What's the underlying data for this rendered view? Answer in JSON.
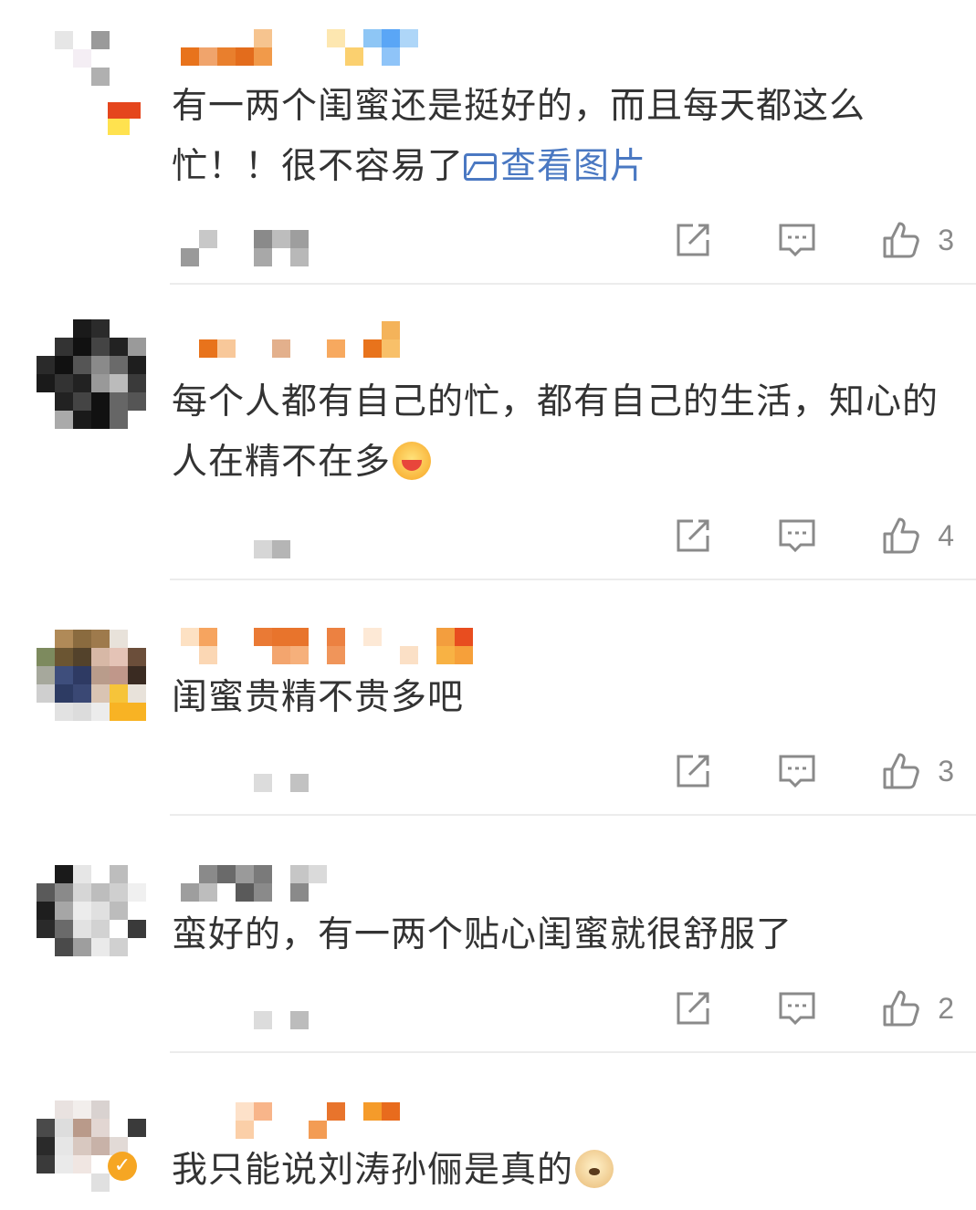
{
  "comments": [
    {
      "text_before": "有一两个闺蜜还是挺好的，而且每天都这么忙！！很不容易了",
      "link_label": "查看图片",
      "link_icon": "picture-icon",
      "likes": "3"
    },
    {
      "text_before": "每个人都有自己的忙，都有自己的生活，知心的人在精不在多",
      "emoji": "hug-emoji",
      "likes": "4"
    },
    {
      "text_before": "闺蜜贵精不贵多吧",
      "likes": "3"
    },
    {
      "text_before": "蛮好的，有一两个贴心闺蜜就很舒服了",
      "likes": "2"
    },
    {
      "text_before": "我只能说刘涛孙俪是真的",
      "emoji": "doge-emoji"
    }
  ],
  "colors": {
    "text": "#333333",
    "link": "#4a78c2",
    "icon": "#8a8a8a",
    "divider": "#ececec"
  }
}
